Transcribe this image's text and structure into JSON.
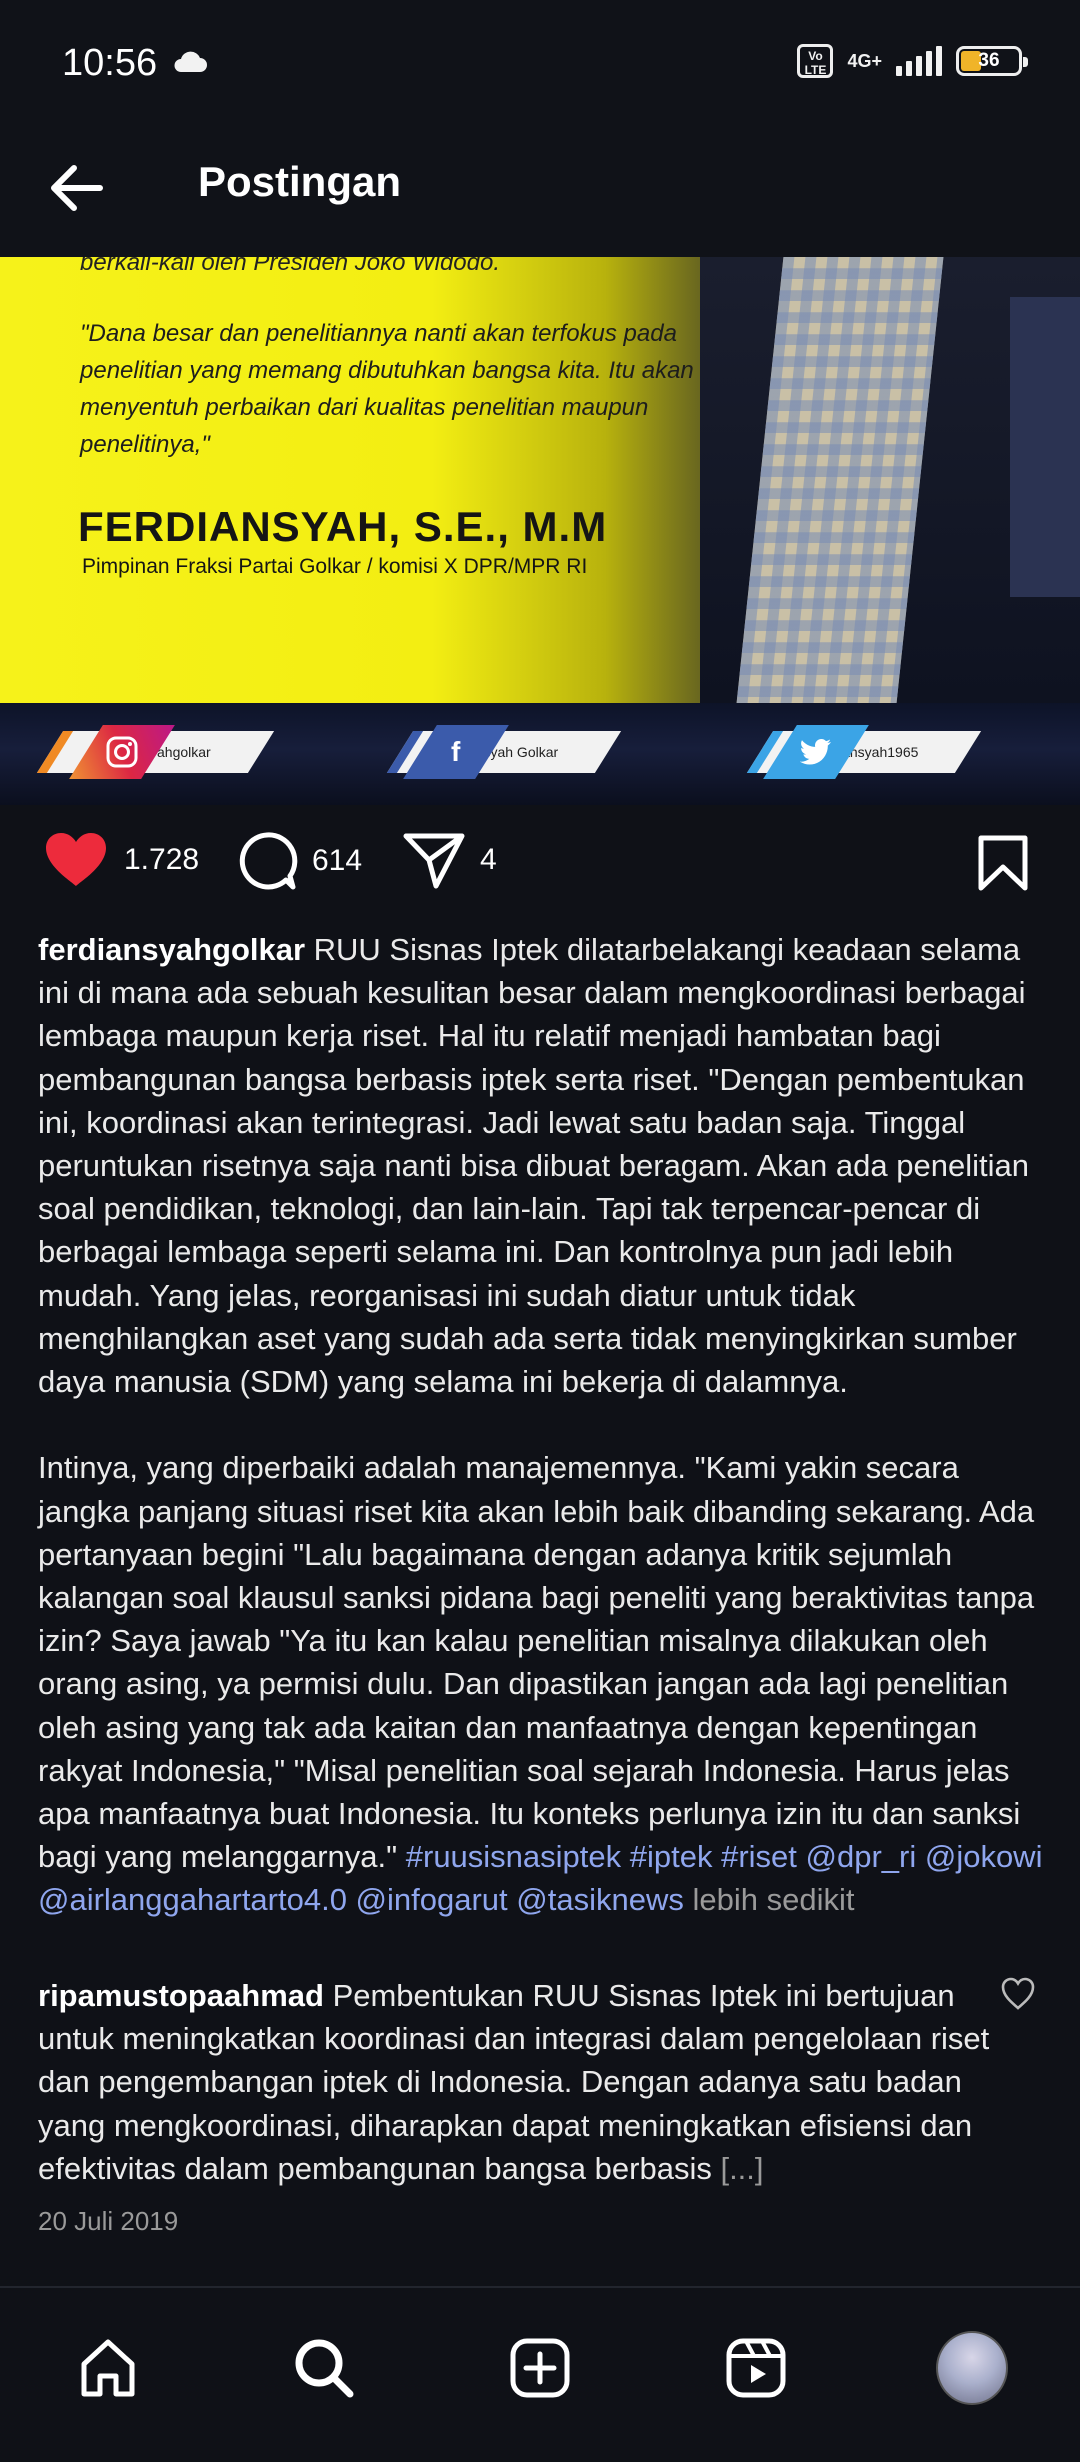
{
  "status_bar": {
    "time": "10:56",
    "weather_icon": "cloud-icon",
    "volte": "Vo LTE",
    "network": "4G+",
    "battery": "36",
    "battery_level_percent": 36
  },
  "header": {
    "back_icon": "arrow-left-icon",
    "title": "Postingan"
  },
  "post_image": {
    "cut_line": "berkali-kali oleh Presiden Joko Widodo.",
    "quote": "\"Dana besar dan penelitiannya nanti akan terfokus pada penelitian yang memang dibutuhkan bangsa kita. Itu akan menyentuh perbaikan dari kualitas penelitian maupun penelitinya,\"",
    "speaker_name": "FERDIANSYAH, S.E., M.M",
    "speaker_role": "Pimpinan Fraksi Partai Golkar / komisi X DPR/MPR RI",
    "socials": [
      {
        "icon": "instagram-icon",
        "handle": "@ferdiansyahgolkar",
        "color": "#d6336c"
      },
      {
        "icon": "facebook-icon",
        "handle": "Ferdiansyah Golkar",
        "color": "#3b5bab"
      },
      {
        "icon": "twitter-icon",
        "handle": "@Ferdiansyah1965",
        "color": "#3ba4e6"
      }
    ]
  },
  "actions": {
    "likes": "1.728",
    "comments": "614",
    "shares": "4",
    "like_color": "#ed2b3c"
  },
  "caption": {
    "username": "ferdiansyahgolkar",
    "text": " RUU Sisnas Iptek dilatarbelakangi keadaan selama ini di mana ada sebuah kesulitan besar dalam mengkoordinasi berbagai lembaga maupun kerja riset. Hal itu relatif menjadi hambatan bagi pembangunan bangsa berbasis iptek serta riset. \"Dengan pembentukan ini, koordinasi akan terintegrasi. Jadi lewat satu badan saja. Tinggal peruntukan risetnya saja nanti bisa dibuat beragam. Akan ada penelitian soal pendidikan, teknologi, dan lain-lain. Tapi tak terpencar-pencar di berbagai lembaga seperti selama ini. Dan kontrolnya pun jadi lebih mudah. Yang jelas, reorganisasi ini sudah diatur untuk tidak menghilangkan aset yang sudah ada serta tidak menyingkirkan sumber daya manusia (SDM) yang selama ini bekerja di dalamnya.\n\nIntinya, yang diperbaiki adalah manajemennya. \"Kami yakin secara jangka panjang situasi riset kita akan lebih baik dibanding sekarang. Ada pertanyaan begini \"Lalu bagaimana dengan adanya kritik sejumlah kalangan soal klausul sanksi pidana bagi peneliti yang beraktivitas tanpa izin? Saya jawab \"Ya itu kan kalau penelitian misalnya dilakukan oleh orang asing, ya permisi dulu. Dan dipastikan jangan ada lagi penelitian oleh asing yang tak ada kaitan dan manfaatnya dengan kepentingan rakyat Indonesia,\" \"Misal penelitian soal sejarah Indonesia. Harus jelas apa manfaatnya buat Indonesia. Itu konteks perlunya izin itu dan sanksi bagi yang melanggarnya.\" ",
    "tags": "#ruusisnasiptek #iptek #riset @dpr_ri @jokowi @airlanggahartarto4.0 @infogarut @tasiknews",
    "less": " lebih sedikit"
  },
  "comment": {
    "username": "ripamustopaahmad",
    "text": " Pembentukan RUU Sisnas Iptek ini bertujuan untuk meningkatkan koordinasi dan integrasi dalam pengelolaan riset dan pengembangan iptek di Indonesia. Dengan adanya satu badan yang mengkoordinasi, diharapkan dapat meningkatkan efisiensi dan efektivitas dalam pembangunan bangsa berbasis ",
    "ellipsis": "[...]"
  },
  "date": "20 Juli 2019",
  "bottom_nav": [
    "home-icon",
    "search-icon",
    "create-icon",
    "reels-icon",
    "profile-avatar"
  ]
}
